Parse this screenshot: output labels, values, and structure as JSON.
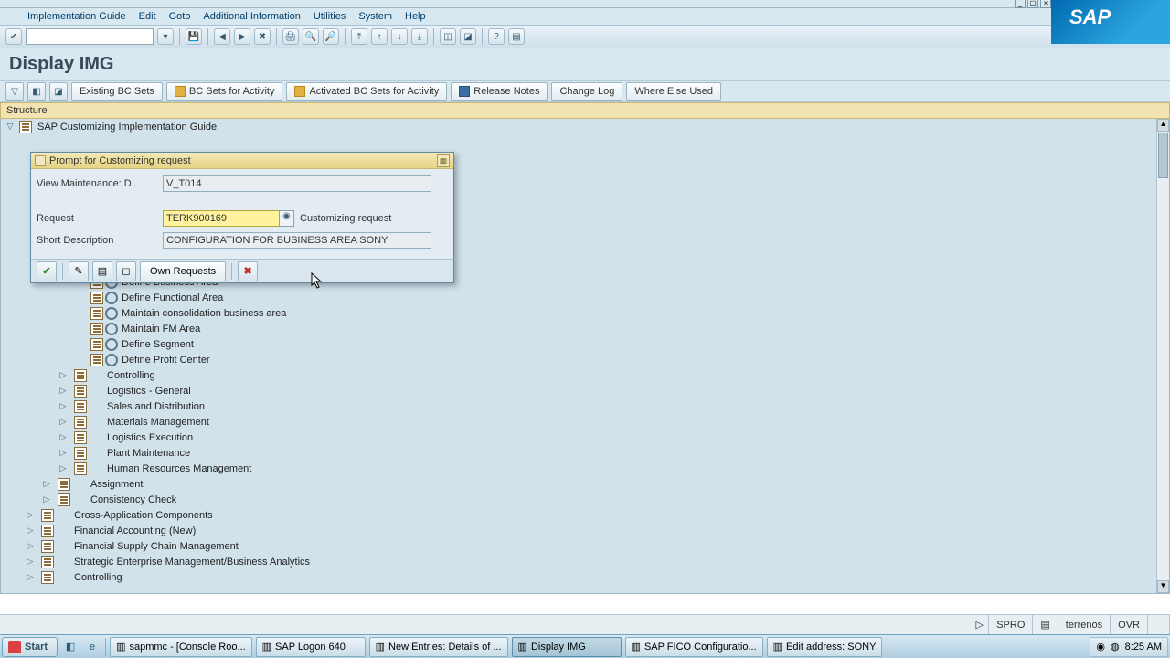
{
  "window": {
    "menus": [
      "Implementation Guide",
      "Edit",
      "Goto",
      "Additional Information",
      "Utilities",
      "System",
      "Help"
    ]
  },
  "logo": {
    "text": "SAP"
  },
  "page": {
    "title": "Display IMG"
  },
  "apptb": {
    "btn1": "Existing BC Sets",
    "btn2": "BC Sets for Activity",
    "btn3": "Activated BC Sets for Activity",
    "btn4": "Release Notes",
    "btn5": "Change Log",
    "btn6": "Where Else Used"
  },
  "structure_hdr": "Structure",
  "tree": {
    "root": "SAP Customizing Implementation Guide",
    "leaf1": "Define Business Area",
    "leaf2": "Define Functional Area",
    "leaf3": "Maintain consolidation business area",
    "leaf4": "Maintain FM Area",
    "leaf5": "Define Segment",
    "leaf6": "Define Profit Center",
    "node7": "Controlling",
    "node8": "Logistics - General",
    "node9": "Sales and Distribution",
    "node10": "Materials Management",
    "node11": "Logistics Execution",
    "node12": "Plant Maintenance",
    "node13": "Human Resources Management",
    "node14": "Assignment",
    "node15": "Consistency Check",
    "node16": "Cross-Application Components",
    "node17": "Financial Accounting (New)",
    "node18": "Financial Supply Chain Management",
    "node19": "Strategic Enterprise Management/Business Analytics",
    "node20": "Controlling"
  },
  "dialog": {
    "title": "Prompt for Customizing request",
    "view_lbl": "View Maintenance: D...",
    "view_val": "V_T014",
    "request_lbl": "Request",
    "request_val": "TERK900169",
    "request_right": "Customizing request",
    "desc_lbl": "Short Description",
    "desc_val": "CONFIGURATION FOR BUSINESS AREA SONY",
    "own_req": "Own Requests"
  },
  "status": {
    "tcode": "SPRO",
    "sys": "terrenos",
    "mode": "OVR"
  },
  "taskbar": {
    "start": "Start",
    "items": [
      "sapmmc - [Console Roo...",
      "SAP Logon 640",
      "New Entries: Details of ...",
      "Display IMG",
      "SAP FICO Configuratio...",
      "Edit address:  SONY"
    ],
    "active_index": 3,
    "time": "8:25 AM"
  }
}
